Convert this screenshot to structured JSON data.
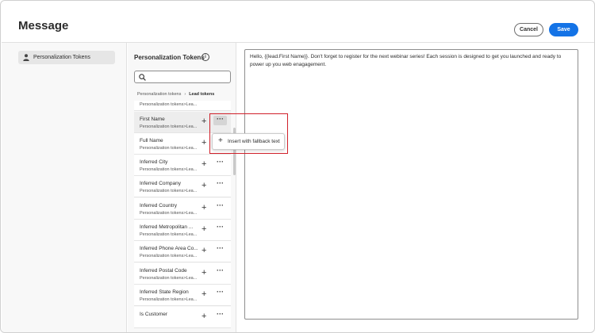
{
  "header": {
    "title": "Message",
    "cancel_label": "Cancel",
    "save_label": "Save"
  },
  "sidebar": {
    "items": [
      {
        "label": "Personalization Tokens",
        "icon": "user-icon"
      }
    ]
  },
  "tokens_panel": {
    "title": "Personalization Tokens",
    "search_placeholder": "",
    "breadcrumb": [
      "Personalization tokens",
      "Lead tokens"
    ],
    "items": [
      {
        "name": "",
        "path": "Personalization tokens>Lea..."
      },
      {
        "name": "First Name",
        "path": "Personalization tokens>Lea..."
      },
      {
        "name": "Full Name",
        "path": "Personalization tokens>Lea..."
      },
      {
        "name": "Inferred City",
        "path": "Personalization tokens>Lea..."
      },
      {
        "name": "Inferred Company",
        "path": "Personalization tokens>Lea..."
      },
      {
        "name": "Inferred Country",
        "path": "Personalization tokens>Lea..."
      },
      {
        "name": "Inferred Metropolitan ...",
        "path": "Personalization tokens>Lea..."
      },
      {
        "name": "Inferred Phone Area Co...",
        "path": "Personalization tokens>Lea..."
      },
      {
        "name": "Inferred Postal Code",
        "path": "Personalization tokens>Lea..."
      },
      {
        "name": "Inferred State Region",
        "path": "Personalization tokens>Lea..."
      },
      {
        "name": "Is Customer",
        "path": ""
      }
    ]
  },
  "popover": {
    "label": "Insert with fallback text"
  },
  "editor": {
    "content": "Hello, {{lead.First Name}}. Don't forget to register for the next webinar series! Each session is designed to get you launched and ready to power up you web enagagement."
  },
  "colors": {
    "accent": "#1473e6",
    "highlight": "#d0202a"
  }
}
